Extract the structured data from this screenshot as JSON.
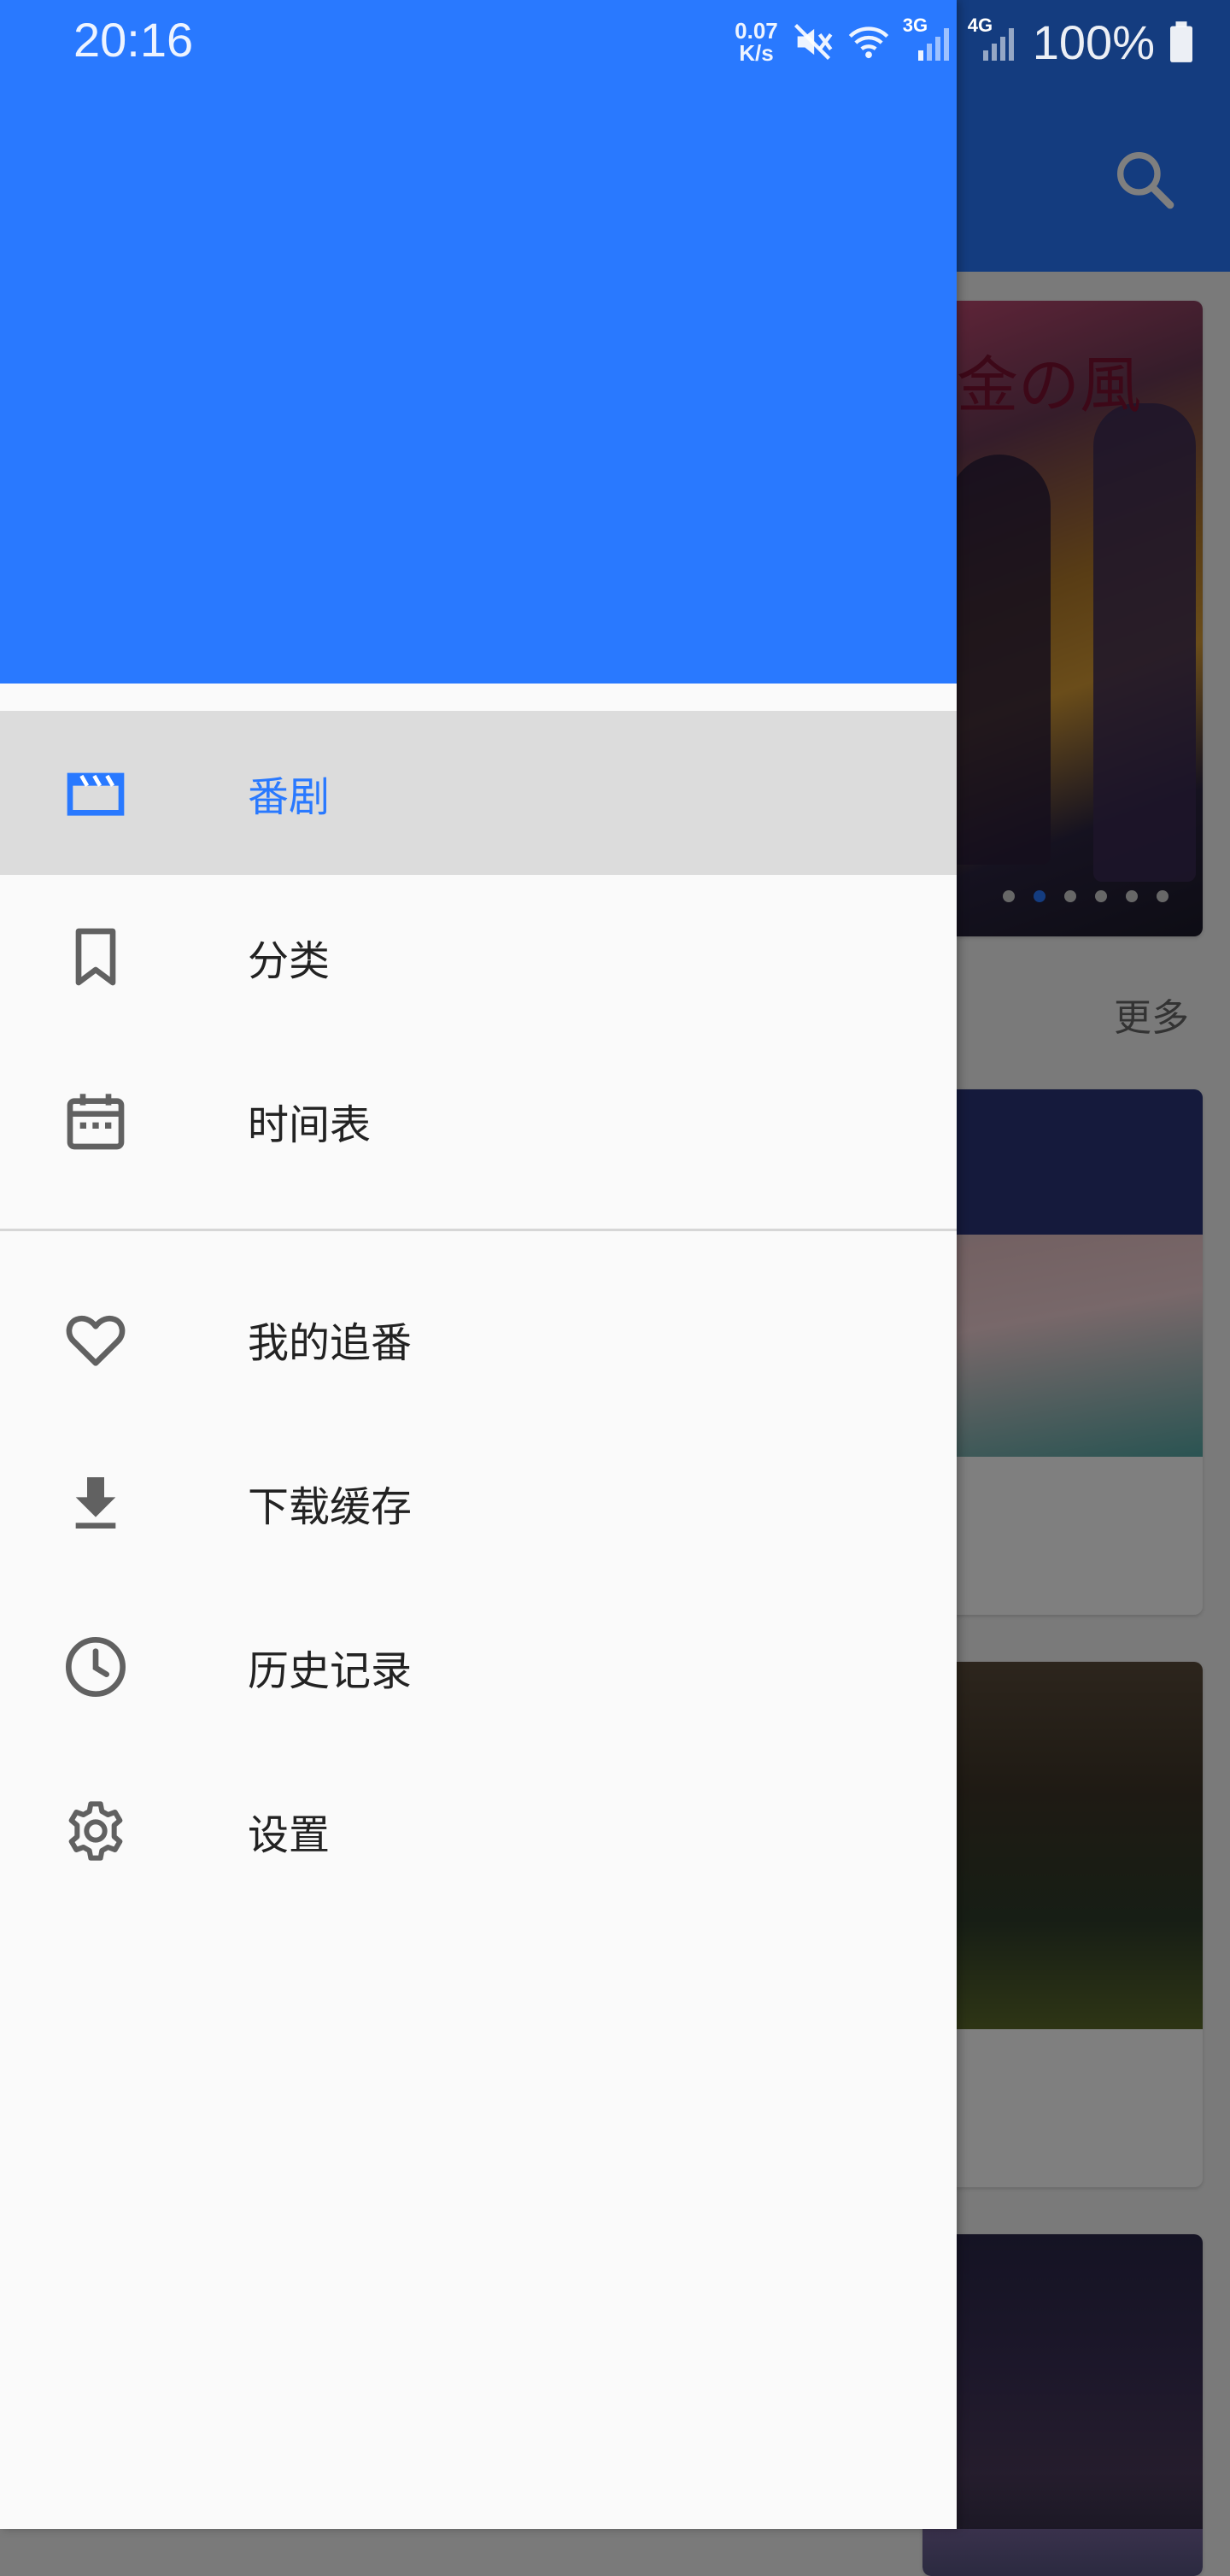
{
  "status_bar": {
    "time": "20:16",
    "net_speed_value": "0.07",
    "net_speed_unit": "K/s",
    "signal_1_label": "3G",
    "signal_2_label": "4G",
    "battery_percent": "100%"
  },
  "background": {
    "banner_title": "金の風",
    "more_label": "更多",
    "banner_page_index": 2,
    "banner_page_count": 6
  },
  "drawer": {
    "menu_primary": [
      {
        "label": "番剧",
        "icon": "clapperboard-icon",
        "active": true
      },
      {
        "label": "分类",
        "icon": "bookmark-icon",
        "active": false
      },
      {
        "label": "时间表",
        "icon": "calendar-icon",
        "active": false
      }
    ],
    "menu_secondary": [
      {
        "label": "我的追番",
        "icon": "heart-icon"
      },
      {
        "label": "下载缓存",
        "icon": "download-icon"
      },
      {
        "label": "历史记录",
        "icon": "clock-icon"
      },
      {
        "label": "设置",
        "icon": "gear-icon"
      }
    ]
  },
  "colors": {
    "accent": "#2979ff",
    "active_item_bg": "#dcdcdc",
    "icon_gray": "#616161"
  }
}
